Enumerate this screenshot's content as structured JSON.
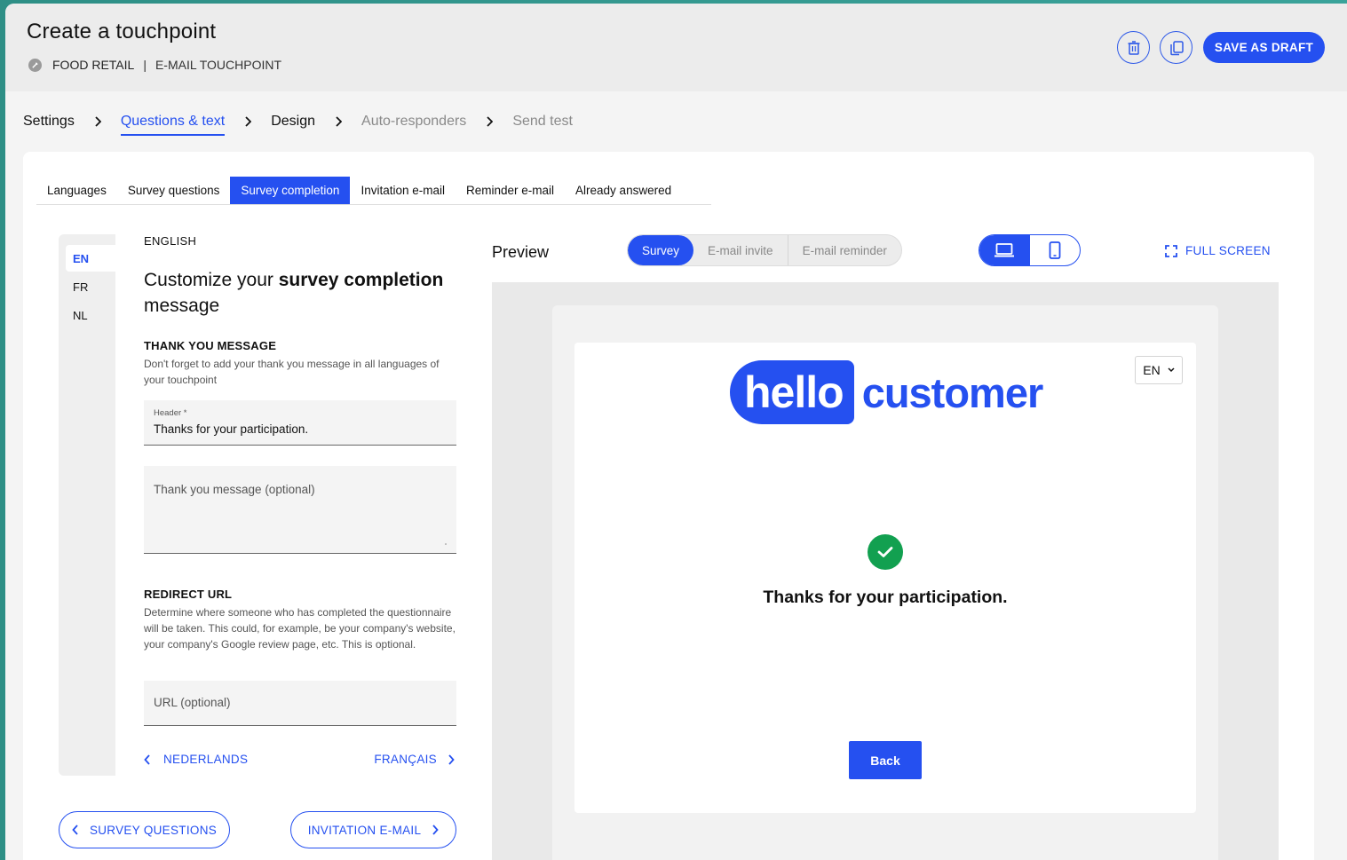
{
  "header": {
    "title": "Create a touchpoint",
    "breadcrumb": {
      "category": "FOOD RETAIL",
      "separator": "|",
      "type": "E-MAIL TOUCHPOINT"
    },
    "save_label": "SAVE AS DRAFT"
  },
  "steps": [
    {
      "label": "Settings",
      "state": "done"
    },
    {
      "label": "Questions & text",
      "state": "active"
    },
    {
      "label": "Design",
      "state": "done"
    },
    {
      "label": "Auto-responders",
      "state": "disabled"
    },
    {
      "label": "Send test",
      "state": "disabled"
    }
  ],
  "tabs": [
    "Languages",
    "Survey questions",
    "Survey completion",
    "Invitation e-mail",
    "Reminder e-mail",
    "Already answered"
  ],
  "active_tab": "Survey completion",
  "languages": [
    {
      "code": "EN",
      "active": true
    },
    {
      "code": "FR",
      "active": false
    },
    {
      "code": "NL",
      "active": false
    }
  ],
  "form": {
    "language_title": "ENGLISH",
    "heading_pre": "Customize your ",
    "heading_bold": "survey completion",
    "heading_post": " message",
    "thank_you": {
      "title": "THANK YOU MESSAGE",
      "desc": "Don't forget to add your thank you message in all languages of your touchpoint",
      "header_label": "Header *",
      "header_value": "Thanks for your participation.",
      "message_placeholder": "Thank you message (optional)"
    },
    "redirect": {
      "title": "REDIRECT URL",
      "desc": "Determine where someone who has completed the questionnaire will be taken. This could, for example, be your company's website, your company's Google review page, etc. This is optional.",
      "url_placeholder": "URL (optional)"
    },
    "prev_lang": "NEDERLANDS",
    "next_lang": "FRANÇAIS"
  },
  "nav_buttons": {
    "prev": "SURVEY QUESTIONS",
    "next": "INVITATION E-MAIL"
  },
  "preview": {
    "label": "Preview",
    "modes": [
      "Survey",
      "E-mail invite",
      "E-mail reminder"
    ],
    "active_mode": "Survey",
    "full_screen": "FULL SCREEN",
    "device_active": "desktop",
    "logo_left": "hello",
    "logo_right": "customer",
    "lang_select": "EN",
    "thanks_text": "Thanks for your participation.",
    "back_label": "Back"
  },
  "colors": {
    "accent": "#2550f0",
    "success": "#12a050",
    "frame": "#3aa39a"
  }
}
